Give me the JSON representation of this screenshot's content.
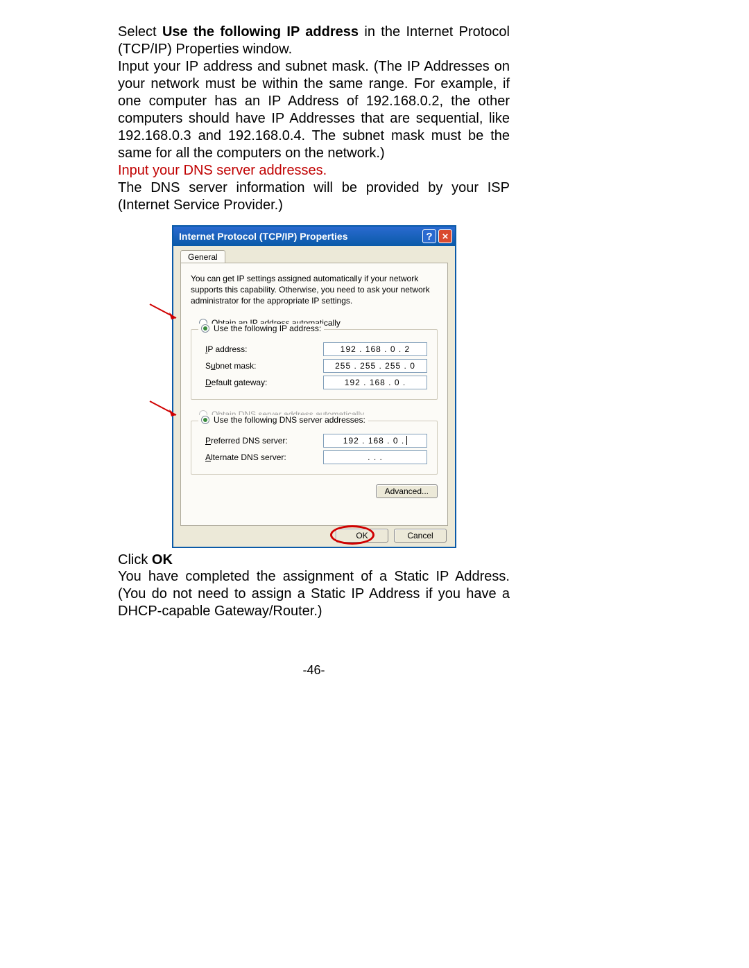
{
  "intro": {
    "part1": "Select ",
    "bold1": "Use the following IP address",
    "part2": " in the Internet Protocol (TCP/IP) Properties window.",
    "para2": "Input your IP address and subnet mask. (The IP Addresses on your network must be within the same range. For example, if one computer has an IP Address of 192.168.0.2, the other computers should have IP Addresses that are sequential, like 192.168.0.3 and 192.168.0.4. The subnet mask must be the same for all the computers on the network.)",
    "red": "Input your DNS server addresses.",
    "para3": "The DNS server information will be provided by your ISP (Internet Service Provider.)"
  },
  "dialog": {
    "title": "Internet Protocol (TCP/IP) Properties",
    "tab": "General",
    "desc": "You can get IP settings assigned automatically if your network supports this capability. Otherwise, you need to ask your network administrator for the appropriate IP settings.",
    "radio_ip_auto": "Obtain an IP address automatically",
    "radio_ip_manual": "Use the following IP address:",
    "ip_label": "IP address:",
    "ip_value": "192 . 168 .   0   .   2",
    "subnet_label": "Subnet mask:",
    "subnet_value": "255 . 255 . 255 .   0",
    "gateway_label": "Default gateway:",
    "gateway_value": "192 .  168  .   0 . ",
    "radio_dns_auto": "Obtain DNS server address automatically",
    "radio_dns_manual": "Use the following DNS server addresses:",
    "pref_dns_label": "Preferred DNS server:",
    "pref_dns_value": "192 .  168  .   0 . ",
    "alt_dns_label": "Alternate DNS server:",
    "alt_dns_value": " .        .        . ",
    "advanced": "Advanced...",
    "ok": "OK",
    "cancel": "Cancel"
  },
  "outro": {
    "click": "Click ",
    "ok": "OK",
    "rest": "You have completed the assignment of a Static IP Address.   (You do not need to assign a Static IP Address if you have a DHCP-capable Gateway/Router.)"
  },
  "page_number": "-46-"
}
